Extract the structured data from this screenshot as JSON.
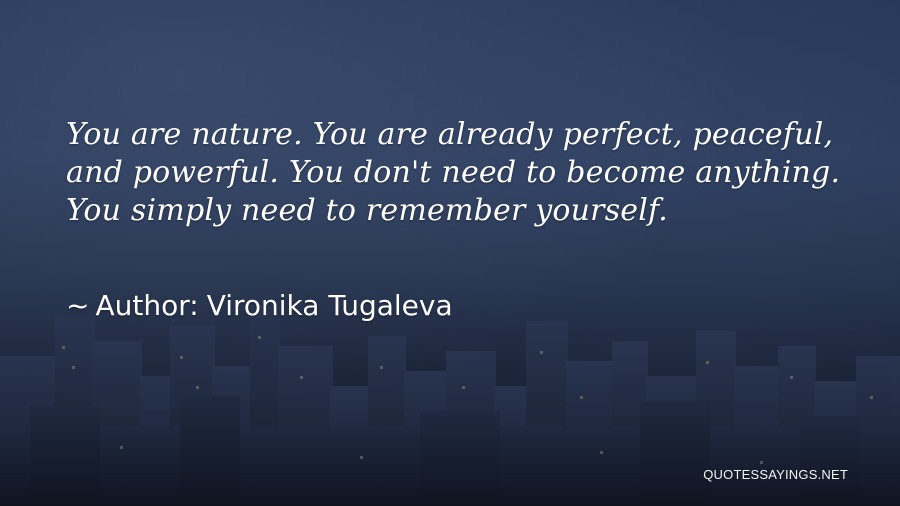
{
  "quote": {
    "text": "You are nature. You are already perfect, peaceful, and powerful. You don't need to become anything. You simply need to remember yourself."
  },
  "author": {
    "tilde": "~",
    "label": "Author:",
    "name": "Vironika Tugaleva"
  },
  "watermark": {
    "text": "QUOTESSAYINGS.NET"
  },
  "background": {
    "scene": "night-city-skyline",
    "tint": "#263657"
  }
}
